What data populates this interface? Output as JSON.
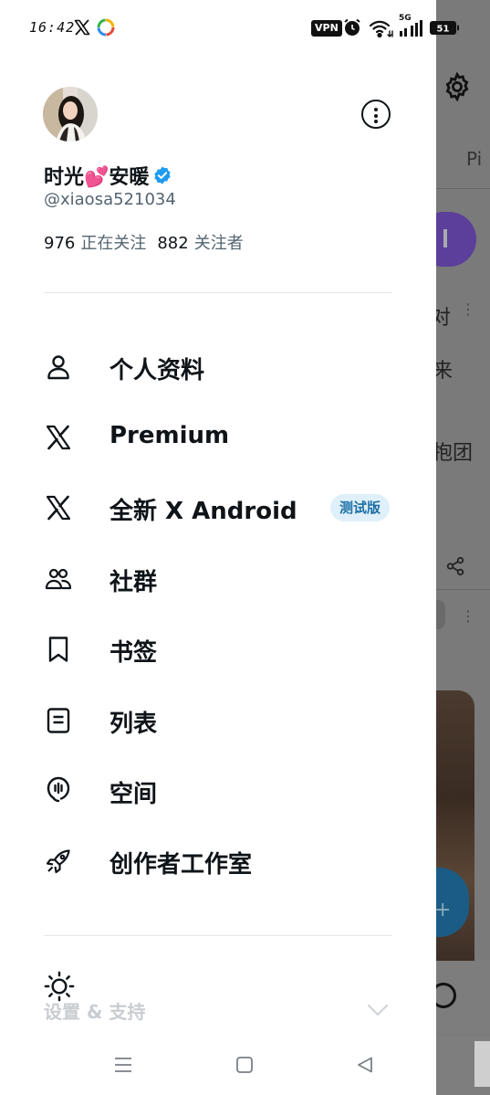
{
  "status_bar": {
    "time": "16:42",
    "vpn": "VPN",
    "network": "5G",
    "battery_level": "51"
  },
  "profile": {
    "display_name": "时光💕安暖",
    "handle": "@xiaosa521034",
    "following_count": "976",
    "following_label": "正在关注",
    "followers_count": "882",
    "followers_label": "关注者"
  },
  "menu": {
    "items": [
      {
        "label": "个人资料",
        "icon": "person-icon"
      },
      {
        "label": "Premium",
        "icon": "x-logo-icon"
      },
      {
        "label": "全新 X Android",
        "icon": "x-logo-icon",
        "badge": "测试版"
      },
      {
        "label": "社群",
        "icon": "communities-icon"
      },
      {
        "label": "书签",
        "icon": "bookmark-icon"
      },
      {
        "label": "列表",
        "icon": "list-icon"
      },
      {
        "label": "空间",
        "icon": "spaces-icon"
      },
      {
        "label": "创作者工作室",
        "icon": "rocket-icon"
      }
    ]
  },
  "settings": {
    "label": "设置 & 支持"
  },
  "background": {
    "tab_partial": "Pi",
    "snippet_1": "对",
    "snippet_2": "来",
    "snippet_3": "抱团"
  },
  "colors": {
    "text_primary": "#0f1419",
    "text_secondary": "#536471",
    "verified_blue": "#1d9bf0",
    "beta_badge_bg": "#dff0fb",
    "beta_badge_text": "#1d6fa5"
  }
}
